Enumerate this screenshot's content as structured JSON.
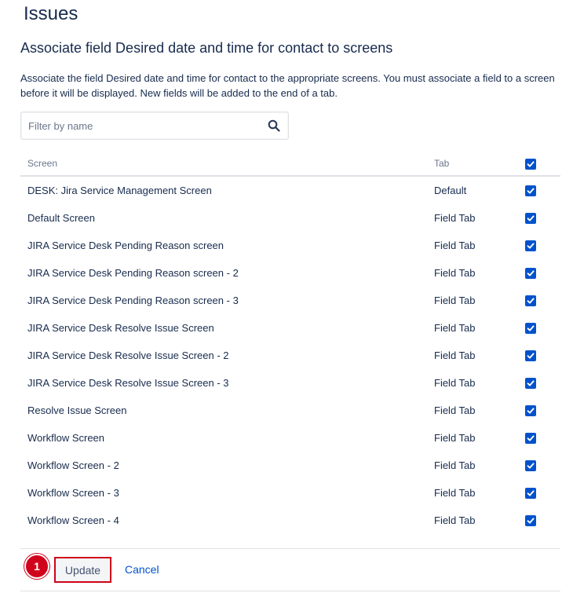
{
  "page": {
    "title": "Issues",
    "subtitle": "Associate field Desired date and time for contact to screens",
    "description": "Associate the field Desired date and time for contact to the appropriate screens. You must associate a field to a screen before it will be displayed. New fields will be added to the end of a tab."
  },
  "filter": {
    "placeholder": "Filter by name",
    "value": "",
    "icon": "search-icon"
  },
  "table": {
    "headers": {
      "screen": "Screen",
      "tab": "Tab",
      "select_all_checked": true
    },
    "rows": [
      {
        "screen": "DESK: Jira Service Management Screen",
        "tab": "Default",
        "checked": true
      },
      {
        "screen": "Default Screen",
        "tab": "Field Tab",
        "checked": true
      },
      {
        "screen": "JIRA Service Desk Pending Reason screen",
        "tab": "Field Tab",
        "checked": true
      },
      {
        "screen": "JIRA Service Desk Pending Reason screen - 2",
        "tab": "Field Tab",
        "checked": true
      },
      {
        "screen": "JIRA Service Desk Pending Reason screen - 3",
        "tab": "Field Tab",
        "checked": true
      },
      {
        "screen": "JIRA Service Desk Resolve Issue Screen",
        "tab": "Field Tab",
        "checked": true
      },
      {
        "screen": "JIRA Service Desk Resolve Issue Screen - 2",
        "tab": "Field Tab",
        "checked": true
      },
      {
        "screen": "JIRA Service Desk Resolve Issue Screen - 3",
        "tab": "Field Tab",
        "checked": true
      },
      {
        "screen": "Resolve Issue Screen",
        "tab": "Field Tab",
        "checked": true
      },
      {
        "screen": "Workflow Screen",
        "tab": "Field Tab",
        "checked": true
      },
      {
        "screen": "Workflow Screen - 2",
        "tab": "Field Tab",
        "checked": true
      },
      {
        "screen": "Workflow Screen - 3",
        "tab": "Field Tab",
        "checked": true
      },
      {
        "screen": "Workflow Screen - 4",
        "tab": "Field Tab",
        "checked": true
      }
    ]
  },
  "actions": {
    "update_label": "Update",
    "cancel_label": "Cancel"
  },
  "annotation": {
    "step_number": "1"
  },
  "colors": {
    "accent": "#0052cc",
    "highlight": "#d0021b",
    "text": "#172b4d",
    "muted": "#6b778c"
  }
}
